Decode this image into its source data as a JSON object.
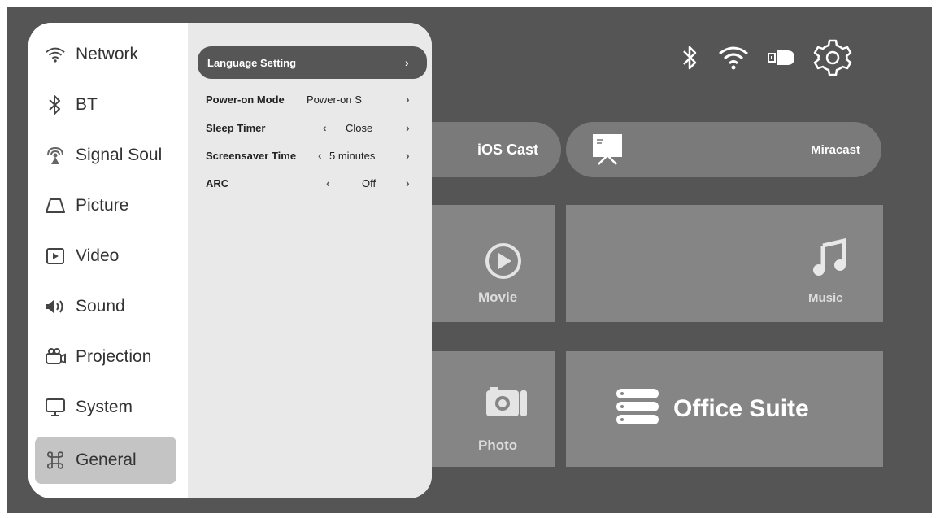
{
  "status_icons": [
    "bluetooth-icon",
    "wifi-icon",
    "input-source-icon",
    "settings-gear-icon"
  ],
  "home": {
    "ios_cast": "iOS Cast",
    "miracast": "Miracast",
    "movie": "Movie",
    "music": "Music",
    "photo": "Photo",
    "office": "Office Suite"
  },
  "sidebar": {
    "items": [
      {
        "label": "Network",
        "icon": "wifi-icon"
      },
      {
        "label": "BT",
        "icon": "bluetooth-icon"
      },
      {
        "label": "Signal Soul",
        "icon": "signal-source-icon"
      },
      {
        "label": "Picture",
        "icon": "picture-icon"
      },
      {
        "label": "Video",
        "icon": "video-icon"
      },
      {
        "label": "Sound",
        "icon": "speaker-icon"
      },
      {
        "label": "Projection",
        "icon": "projection-icon"
      },
      {
        "label": "System",
        "icon": "monitor-icon"
      },
      {
        "label": "General",
        "icon": "command-icon"
      }
    ],
    "selected": "General"
  },
  "settings": {
    "language": {
      "title": "Language Setting"
    },
    "power_on_mode": {
      "title": "Power-on Mode",
      "value": "Power-on S"
    },
    "sleep_timer": {
      "title": "Sleep Timer",
      "value": "Close"
    },
    "screensaver": {
      "title": "Screensaver Time",
      "value": "5 minutes"
    },
    "arc": {
      "title": "ARC",
      "value": "Off"
    }
  },
  "colors": {
    "panel_bg": "#555555",
    "tile": "#858585",
    "highlight": "#565656"
  }
}
